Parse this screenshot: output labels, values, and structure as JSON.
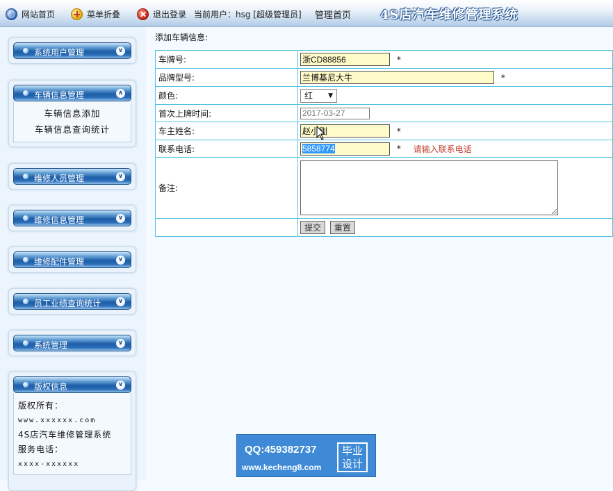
{
  "topbar": {
    "home": "网站首页",
    "collapse": "菜单折叠",
    "logout": "退出登录",
    "current_user": "当前用户：hsg [超级管理员]",
    "admin_home": "管理首页",
    "system_title": "4S店汽车维修管理系统"
  },
  "sidebar": {
    "groups": [
      {
        "label": "系统用户管理",
        "expanded": false
      },
      {
        "label": "车辆信息管理",
        "expanded": true,
        "items": [
          "车辆信息添加",
          "车辆信息查询统计"
        ]
      },
      {
        "label": "维修人员管理",
        "expanded": false
      },
      {
        "label": "维修信息管理",
        "expanded": false
      },
      {
        "label": "维修配件管理",
        "expanded": false
      },
      {
        "label": "员工业绩查询统计",
        "expanded": false
      },
      {
        "label": "系统管理",
        "expanded": false
      },
      {
        "label": "版权信息",
        "expanded": true,
        "lines": [
          "版权所有：",
          "www.xxxxxx.com",
          "4S店汽车维修管理系统",
          "服务电话：",
          "xxxx-xxxxxx"
        ]
      }
    ]
  },
  "main": {
    "title": "添加车辆信息:",
    "rows": {
      "plate": {
        "label": "车牌号:",
        "value": "浙CD88856",
        "required": "*"
      },
      "model": {
        "label": "品牌型号:",
        "value": "兰博基尼大牛",
        "required": "*"
      },
      "color": {
        "label": "颜色:",
        "value": "红"
      },
      "first_date": {
        "label": "首次上牌时间:",
        "value": "2017-03-27"
      },
      "owner": {
        "label": "车主姓名:",
        "value": "赵小刚",
        "required": "*"
      },
      "phone": {
        "label": "联系电话:",
        "value": "5858774",
        "required": "*",
        "error": "请输入联系电话"
      },
      "remark": {
        "label": "备注:",
        "value": ""
      }
    },
    "submit": "提交",
    "reset": "重置"
  },
  "watermark": {
    "qq": "QQ:459382737",
    "url": "www.kecheng8.com",
    "badge_line1": "毕业",
    "badge_line2": "设计"
  },
  "colors": {
    "accent": "#1d5ea8",
    "table_border": "#4ec3e0",
    "input_bg": "#fffbc8",
    "error": "#c0392b"
  }
}
